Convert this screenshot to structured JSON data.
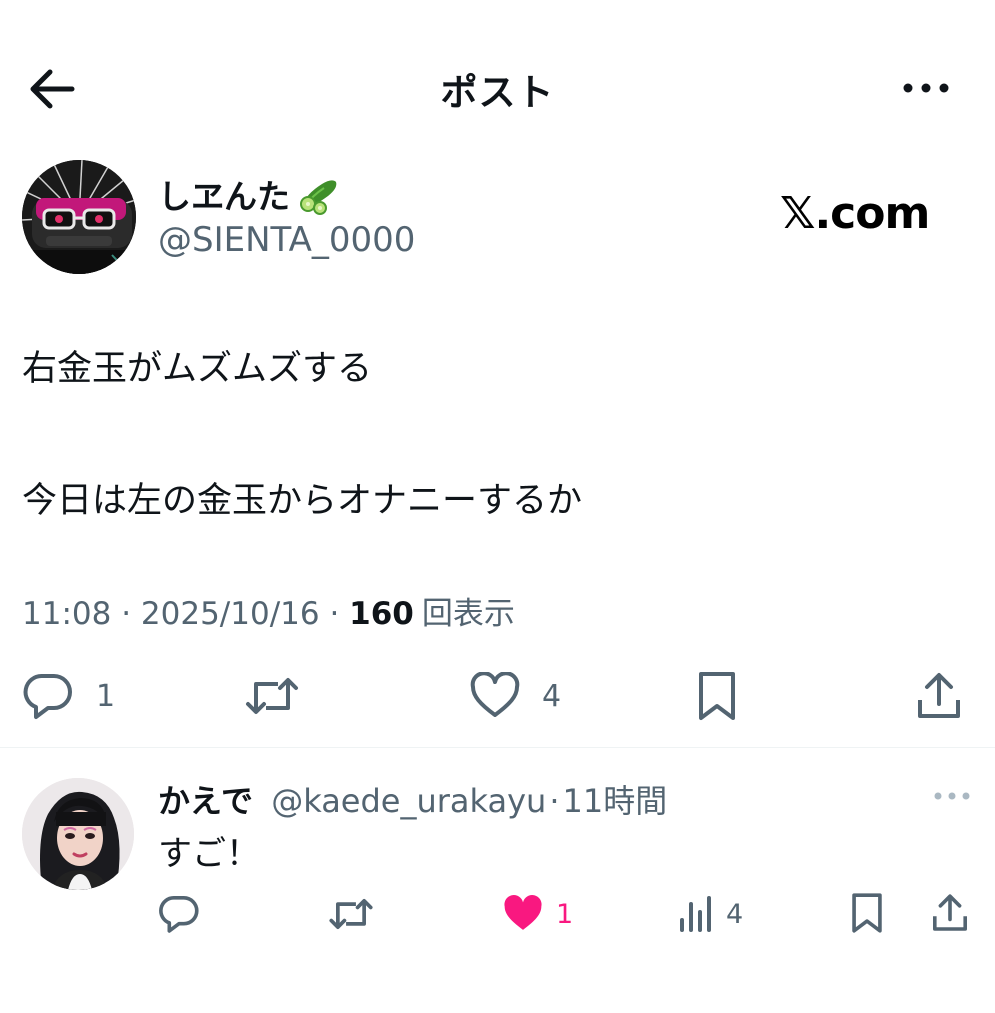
{
  "header": {
    "title": "ポスト"
  },
  "post": {
    "author_name": "しヱんた",
    "author_handle": "@SIENTA_0000",
    "watermark": "𝕏.com",
    "line1": "右金玉がムズムズする",
    "line2": "今日は左の金玉からオナニーするか",
    "time": "11:08",
    "date": "2025/10/16",
    "views_count": "160",
    "views_label": "回表示",
    "sep": " · ",
    "reply_count": "1",
    "like_count": "4"
  },
  "reply": {
    "name": "かえで",
    "handle": "@kaede_urakayu",
    "sep": "·",
    "time": "11時間",
    "text": "すご！",
    "like_count": "1",
    "views_count": "4"
  },
  "colors": {
    "secondary": "#536471",
    "like_active": "#f91880",
    "text": "#0f1419"
  },
  "icons": [
    "back-arrow-icon",
    "more-icon",
    "cucumber-emoji-icon",
    "reply-icon",
    "repost-icon",
    "like-icon",
    "bookmark-icon",
    "share-icon",
    "views-icon"
  ]
}
